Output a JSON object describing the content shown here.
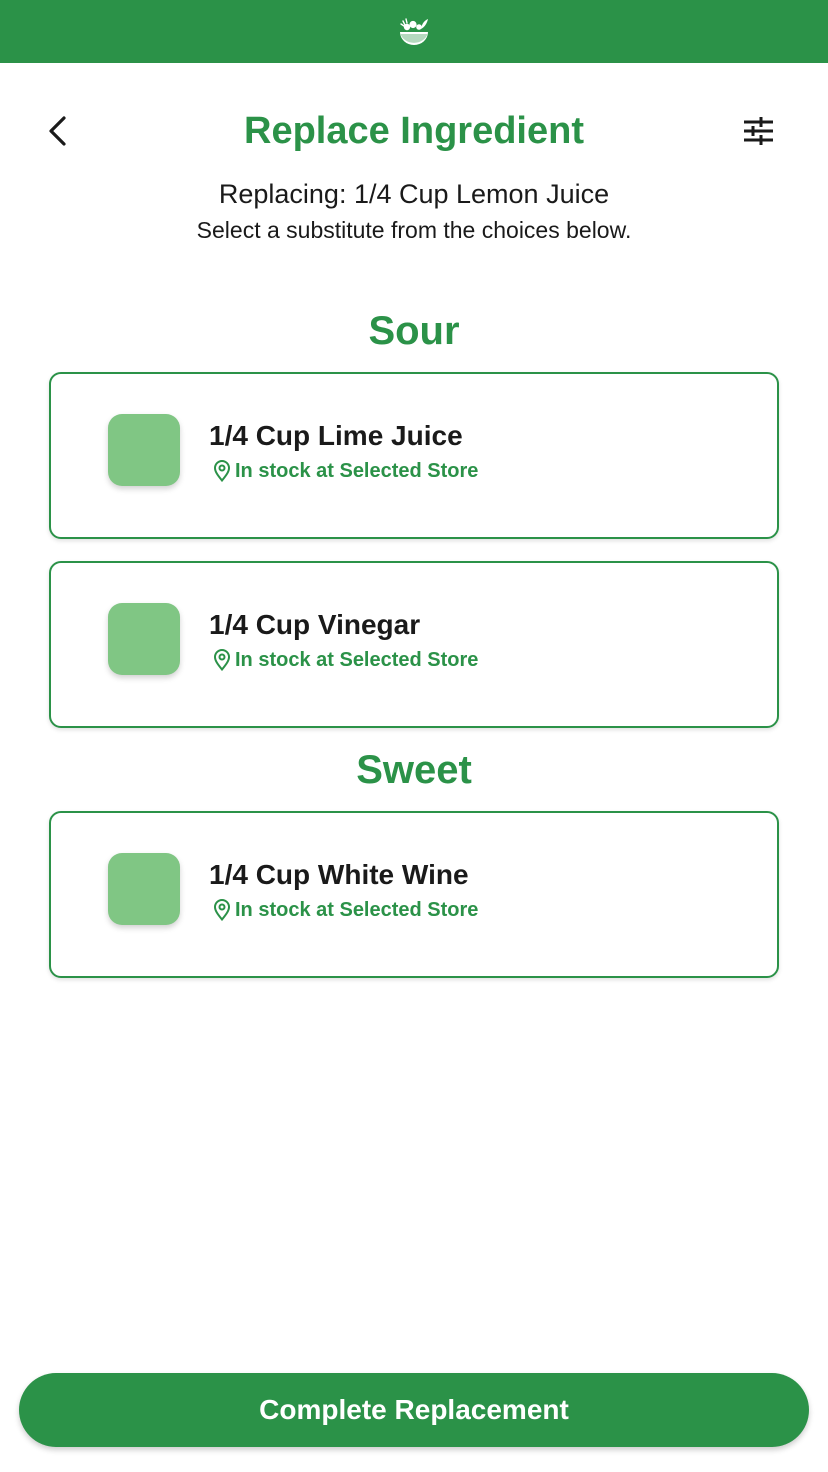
{
  "colors": {
    "brand_green": "#2b9248",
    "thumb_green": "#80c684",
    "text_dark": "#1a1a1a",
    "background": "#ffffff"
  },
  "header": {
    "logo_icon": "salad-bowl-icon",
    "back_icon": "chevron-left-icon",
    "filter_icon": "sliders-icon",
    "title": "Replace Ingredient"
  },
  "replacing": {
    "text": "Replacing: 1/4 Cup Lemon Juice",
    "instruction": "Select a substitute from the choices below."
  },
  "sections": [
    {
      "heading": "Sour",
      "options": [
        {
          "name": "1/4 Cup Lime Juice",
          "stock": "In stock at Selected Store"
        },
        {
          "name": "1/4 Cup Vinegar",
          "stock": "In stock at Selected Store"
        }
      ]
    },
    {
      "heading": "Sweet",
      "options": [
        {
          "name": "1/4 Cup White Wine",
          "stock": "In stock at Selected Store"
        }
      ]
    }
  ],
  "footer": {
    "complete_label": "Complete Replacement"
  }
}
